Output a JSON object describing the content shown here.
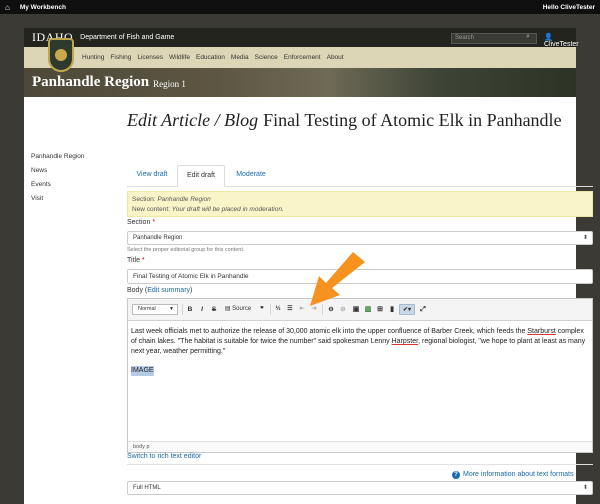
{
  "admin_bar": {
    "home_icon": "house-icon",
    "workbench": "My Workbench",
    "greeting": "Hello CliveTester"
  },
  "site": {
    "logo": "IDAHO",
    "department": "Department of Fish and Game",
    "search_placeholder": "Search",
    "user": "CliveTester",
    "nav": [
      "Hunting",
      "Fishing",
      "Licenses",
      "Wildlife",
      "Education",
      "Media",
      "Science",
      "Enforcement",
      "About"
    ]
  },
  "banner": {
    "region": "Panhandle Region",
    "sub": "Region 1"
  },
  "left_nav": [
    "Panhandle Region",
    "News",
    "Events",
    "Visit"
  ],
  "page": {
    "title_italic": "Edit Article / Blog",
    "title_rest": "Final Testing of Atomic Elk in Panhandle"
  },
  "tabs": [
    "View draft",
    "Edit draft",
    "Moderate"
  ],
  "notice": {
    "section_label": "Section:",
    "section_value": "Panhandle Region",
    "new_label": "New content:",
    "new_value": "Your draft will be placed in moderation."
  },
  "section_field": {
    "label": "Section",
    "value": "Panhandle Region",
    "help": "Select the proper editorial group for this content."
  },
  "title_field": {
    "label": "Title",
    "value": "Final Testing of Atomic Elk in Panhandle"
  },
  "body_field": {
    "label": "Body",
    "edit_summary": "Edit summary"
  },
  "toolbar": {
    "format": "Normal",
    "source": "Source"
  },
  "editor": {
    "part1": "Last week officials met to authorize the release of 30,000 atomic elk into the upper confluence of Barber Creek, which feeds the",
    "word_starburst": "Starburst",
    "part2": "complex of chain lakes. \"The habitat is suitable for twice the number\" said spokesman Lenny",
    "word_harpster": "Harpster",
    "part3": ", regional biologist, \"we hope to plant at least as many next year, weather permitting.\"",
    "selected": "IMAGE",
    "status": "body  p"
  },
  "switch_link": "Switch to rich text editor",
  "more_info": "More information about text formats",
  "text_format": "Full HTML",
  "colors": {
    "accent_link": "#1a6aab",
    "arrow": "#f7921e",
    "notice_bg": "#faf5c8"
  }
}
